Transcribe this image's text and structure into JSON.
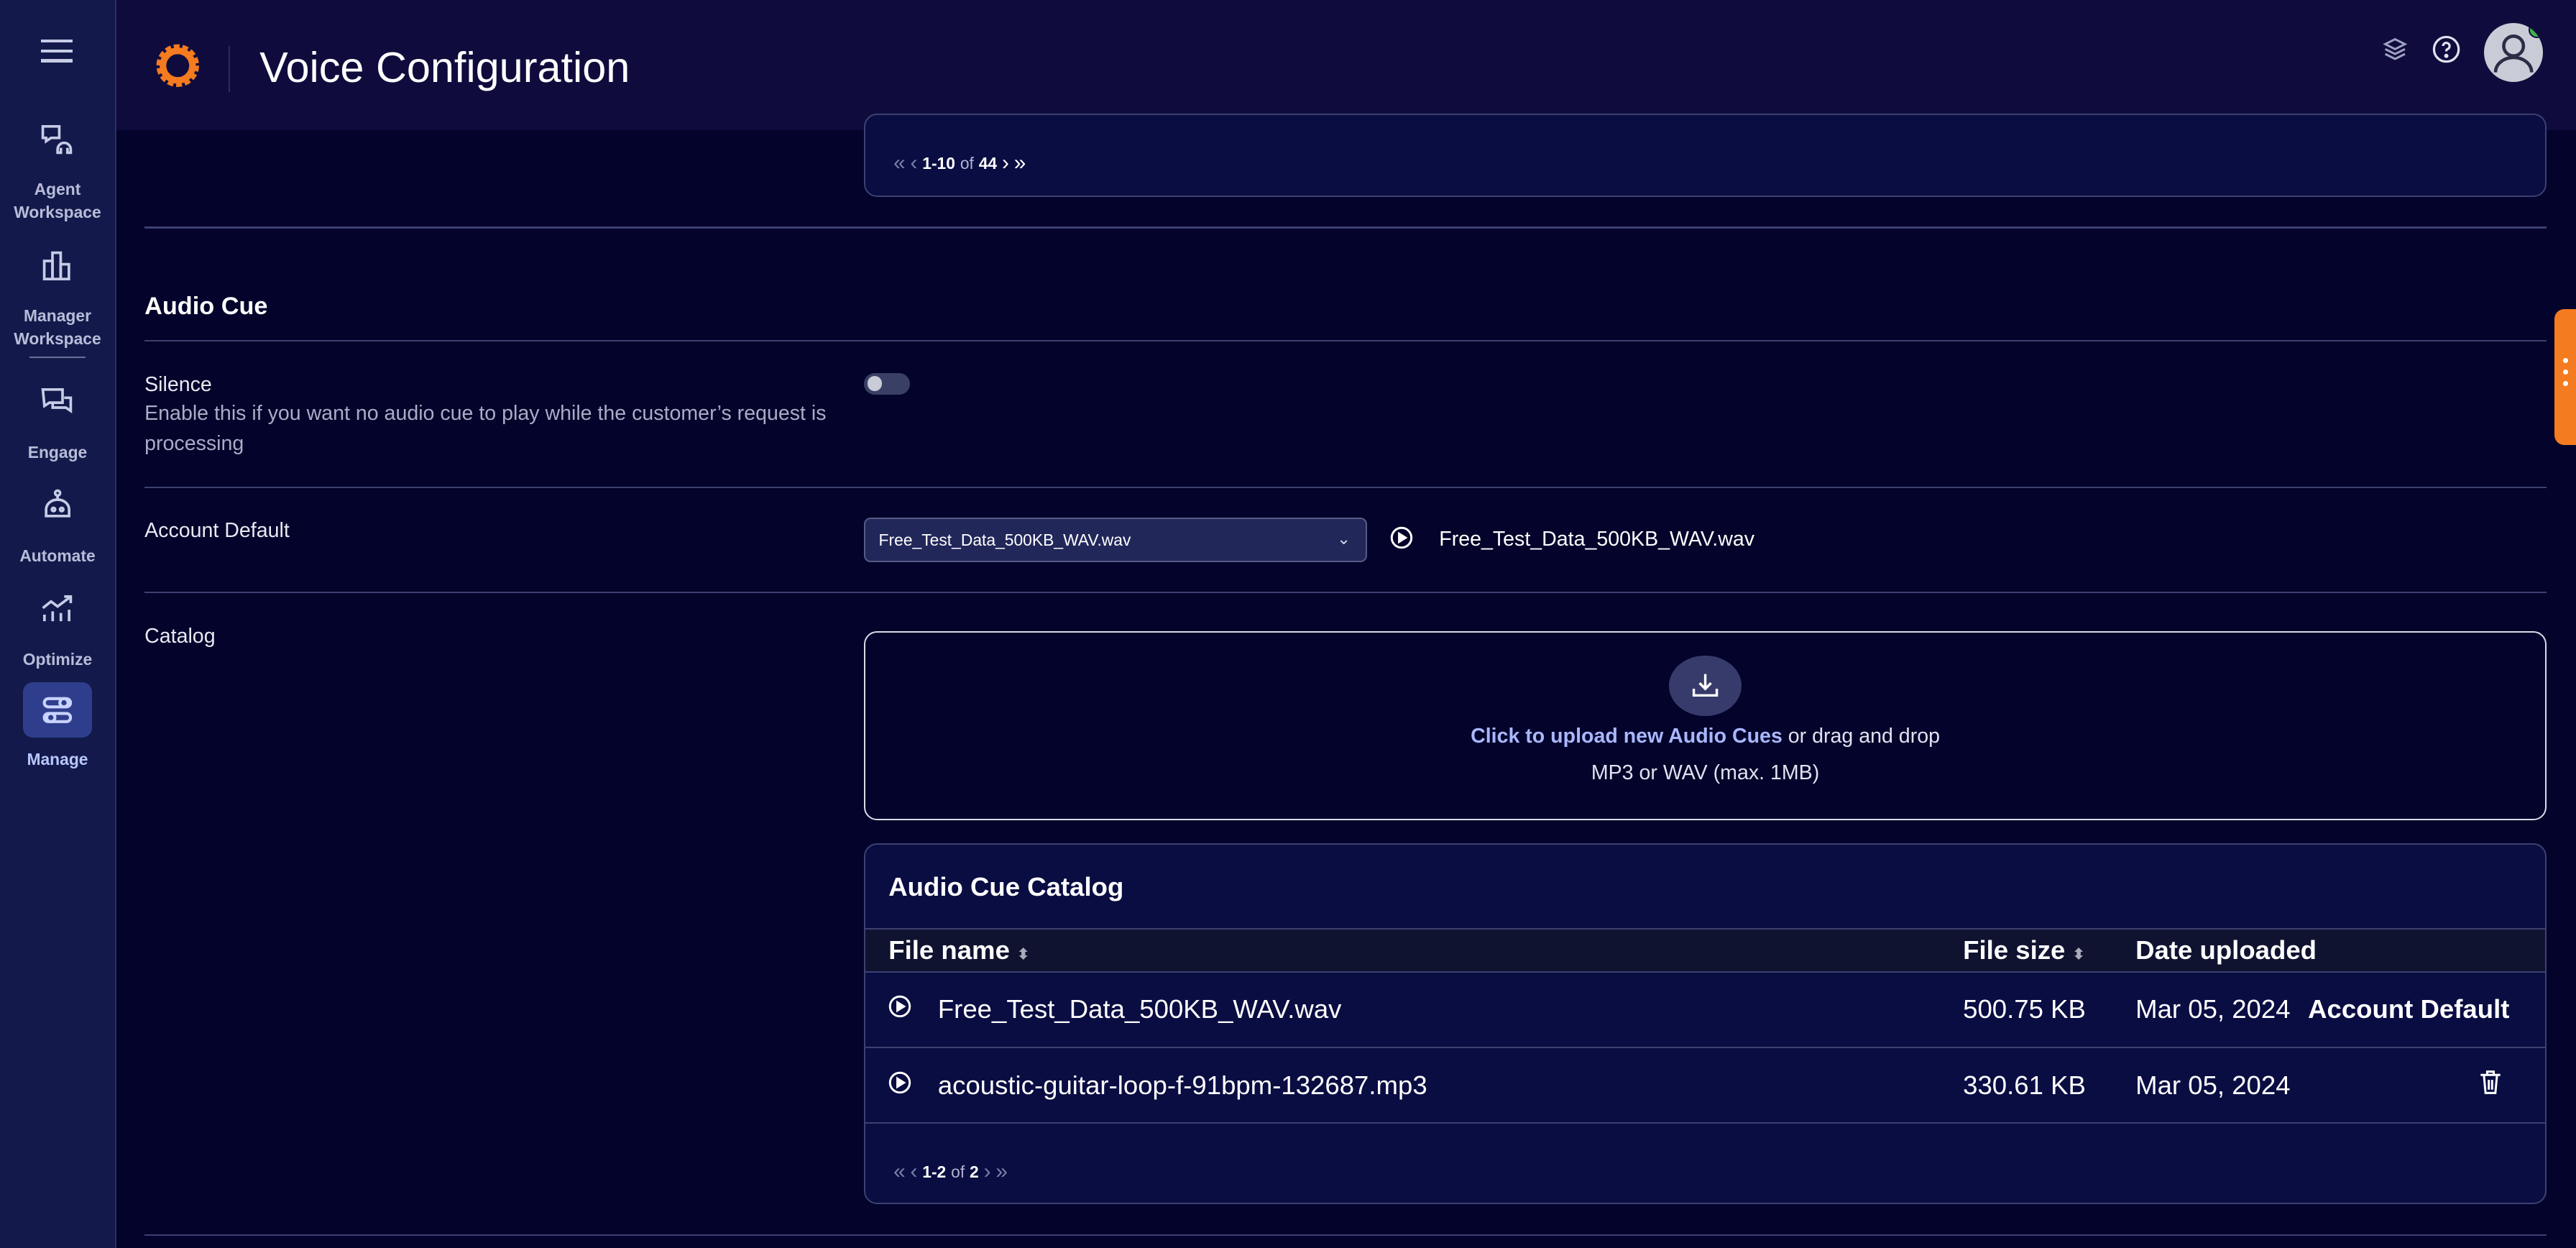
{
  "app": {
    "title": "Voice Configuration",
    "brand_color": "#f47b20"
  },
  "sidebar": {
    "items": [
      {
        "label": "Agent Workspace",
        "icon": "agent-headset-icon"
      },
      {
        "label": "Manager Workspace",
        "icon": "bar-chart-icon"
      },
      {
        "label": "Engage",
        "icon": "chat-bubbles-icon"
      },
      {
        "label": "Automate",
        "icon": "robot-icon"
      },
      {
        "label": "Optimize",
        "icon": "trend-chart-icon"
      },
      {
        "label": "Manage",
        "icon": "toggles-icon",
        "active": true
      }
    ]
  },
  "top_pager": {
    "range": "1-10",
    "of": "of",
    "total": "44"
  },
  "audio_cue": {
    "heading": "Audio Cue",
    "silence": {
      "label": "Silence",
      "description": "Enable this if you want no audio cue to play while the customer’s request is processing",
      "enabled": false
    },
    "account_default": {
      "label": "Account Default",
      "selected": "Free_Test_Data_500KB_WAV.wav",
      "preview": "Free_Test_Data_500KB_WAV.wav"
    },
    "catalog": {
      "label": "Catalog",
      "upload": {
        "link": "Click to upload new Audio Cues",
        "rest": " or drag and drop",
        "hint": "MP3 or WAV (max. 1MB)"
      },
      "table": {
        "title": "Audio Cue Catalog",
        "columns": [
          "File name",
          "File size",
          "Date uploaded"
        ],
        "rows": [
          {
            "name": "Free_Test_Data_500KB_WAV.wav",
            "size": "500.75 KB",
            "date": "Mar 05, 2024",
            "tag": "Account Default"
          },
          {
            "name": "acoustic-guitar-loop-f-91bpm-132687.mp3",
            "size": "330.61 KB",
            "date": "Mar 05, 2024",
            "tag": ""
          }
        ],
        "pager": {
          "range": "1-2",
          "of": "of",
          "total": "2"
        }
      }
    }
  }
}
